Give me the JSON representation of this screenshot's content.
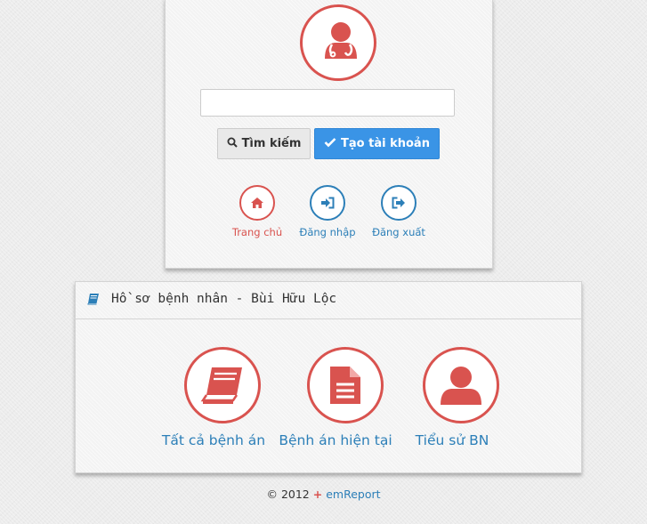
{
  "search": {
    "value": "",
    "placeholder": ""
  },
  "buttons": {
    "search_label": "Tìm kiếm",
    "register_label": "Tạo tài khoản"
  },
  "nav": [
    {
      "label": "Trang chủ",
      "icon": "home-icon"
    },
    {
      "label": "Đăng nhập",
      "icon": "sign-in-icon"
    },
    {
      "label": "Đăng xuất",
      "icon": "sign-out-icon"
    }
  ],
  "record_panel": {
    "title": "Hồ sơ bệnh nhân - Bùi Hữu Lộc",
    "icon": "book-icon",
    "items": [
      {
        "label": "Tất cả bệnh án",
        "icon": "books-icon"
      },
      {
        "label": "Bệnh án hiện tại",
        "icon": "document-icon"
      },
      {
        "label": "Tiểu sử BN",
        "icon": "user-icon"
      }
    ]
  },
  "footer": {
    "copyright": "© 2012",
    "plus": "+",
    "brand": "emReport"
  },
  "colors": {
    "accent_red": "#d9534f",
    "link_blue": "#2c7fb8",
    "primary_button": "#3a94e6"
  }
}
